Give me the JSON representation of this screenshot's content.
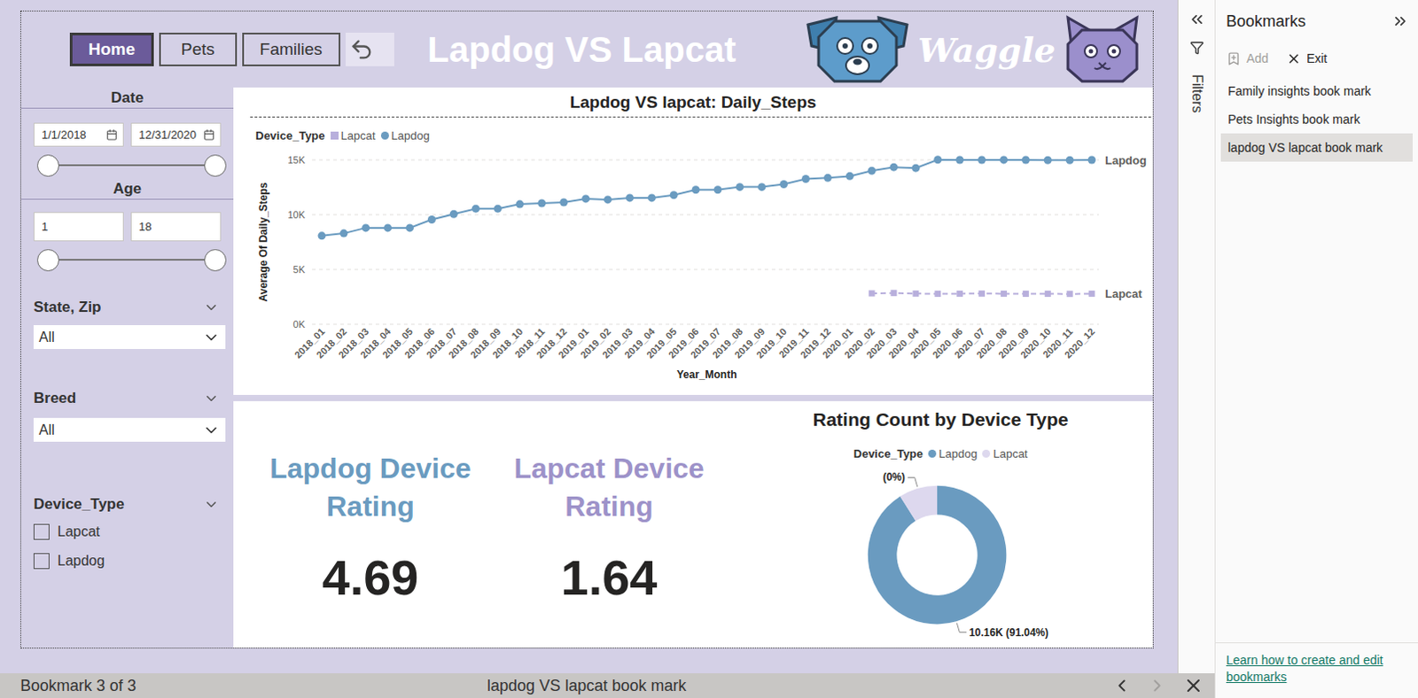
{
  "nav": {
    "buttons": [
      {
        "label": "Home",
        "selected": true
      },
      {
        "label": "Pets",
        "selected": false
      },
      {
        "label": "Families",
        "selected": false
      }
    ]
  },
  "header": {
    "title": "Lapdog VS Lapcat",
    "logo_text": "Waggle"
  },
  "slicers": {
    "date": {
      "label": "Date",
      "from": "1/1/2018",
      "to": "12/31/2020",
      "low": 0,
      "high": 1
    },
    "age": {
      "label": "Age",
      "from": "1",
      "to": "18",
      "low": 0,
      "high": 1
    },
    "state_zip": {
      "label": "State, Zip",
      "value": "All"
    },
    "breed": {
      "label": "Breed",
      "value": "All"
    },
    "device_type": {
      "label": "Device_Type",
      "options": [
        {
          "label": "Lapcat",
          "checked": false
        },
        {
          "label": "Lapdog",
          "checked": false
        }
      ]
    }
  },
  "line_chart": {
    "title": "Lapdog VS lapcat: Daily_Steps",
    "legend_title": "Device_Type",
    "y_axis_title": "Average Of Daily_Steps",
    "x_axis_title": "Year_Month",
    "y_ticks": [
      {
        "label": "0K",
        "value": 0
      },
      {
        "label": "5K",
        "value": 5000
      },
      {
        "label": "10K",
        "value": 10000
      },
      {
        "label": "15K",
        "value": 15000
      }
    ],
    "categories": [
      "2018_01",
      "2018_02",
      "2018_03",
      "2018_04",
      "2018_05",
      "2018_06",
      "2018_07",
      "2018_08",
      "2018_09",
      "2018_10",
      "2018_11",
      "2018_12",
      "2019_01",
      "2019_02",
      "2019_03",
      "2019_04",
      "2019_05",
      "2019_06",
      "2019_07",
      "2019_08",
      "2019_09",
      "2019_10",
      "2019_11",
      "2019_12",
      "2020_01",
      "2020_02",
      "2020_03",
      "2020_04",
      "2020_05",
      "2020_06",
      "2020_07",
      "2020_08",
      "2020_09",
      "2020_10",
      "2020_11",
      "2020_12"
    ],
    "series": [
      {
        "name": "Lapcat",
        "kind": "dashed",
        "color": "#b8afdc",
        "values": [
          null,
          null,
          null,
          null,
          null,
          null,
          null,
          null,
          null,
          null,
          null,
          null,
          null,
          null,
          null,
          null,
          null,
          null,
          null,
          null,
          null,
          null,
          null,
          null,
          null,
          2820,
          2850,
          2800,
          2780,
          2790,
          2800,
          2790,
          2780,
          2780,
          2770,
          2790
        ]
      },
      {
        "name": "Lapdog",
        "kind": "solid",
        "color": "#6a9bc0",
        "values": [
          8080,
          8300,
          8800,
          8800,
          8800,
          9560,
          10060,
          10550,
          10550,
          10960,
          11050,
          11130,
          11460,
          11380,
          11540,
          11540,
          11790,
          12280,
          12280,
          12530,
          12530,
          12780,
          13270,
          13360,
          13520,
          14010,
          14340,
          14260,
          15020,
          15000,
          15000,
          15010,
          15000,
          14980,
          14980,
          15000
        ]
      }
    ]
  },
  "kpis": [
    {
      "title": "Lapdog Device Rating",
      "value": "4.69",
      "color": "#6a9bc0"
    },
    {
      "title": "Lapcat Device Rating",
      "value": "1.64",
      "color": "#9d92c9"
    }
  ],
  "donut": {
    "title": "Rating Count by Device Type",
    "legend_title": "Device_Type",
    "slices": [
      {
        "name": "Lapdog",
        "value": 10160,
        "label": "10.16K (91.04%)",
        "color": "#6a9bc0"
      },
      {
        "name": "Lapcat",
        "value": 1000,
        "label": "(0%)",
        "color": "#ddd8ee"
      }
    ]
  },
  "filters_pane": {
    "label": "Filters"
  },
  "bookmarks_pane": {
    "title": "Bookmarks",
    "actions": [
      {
        "label": "Add",
        "disabled": true
      },
      {
        "label": "Exit",
        "disabled": false
      }
    ],
    "items": [
      {
        "label": "Family insights book mark",
        "selected": false
      },
      {
        "label": "Pets Insights book mark",
        "selected": false
      },
      {
        "label": "lapdog VS lapcat book mark",
        "selected": true
      }
    ],
    "link": "Learn how to create and edit bookmarks"
  },
  "status_bar": {
    "position": "Bookmark 3 of 3",
    "name": "lapdog VS lapcat book mark",
    "prev_disabled": false,
    "next_disabled": true
  }
}
